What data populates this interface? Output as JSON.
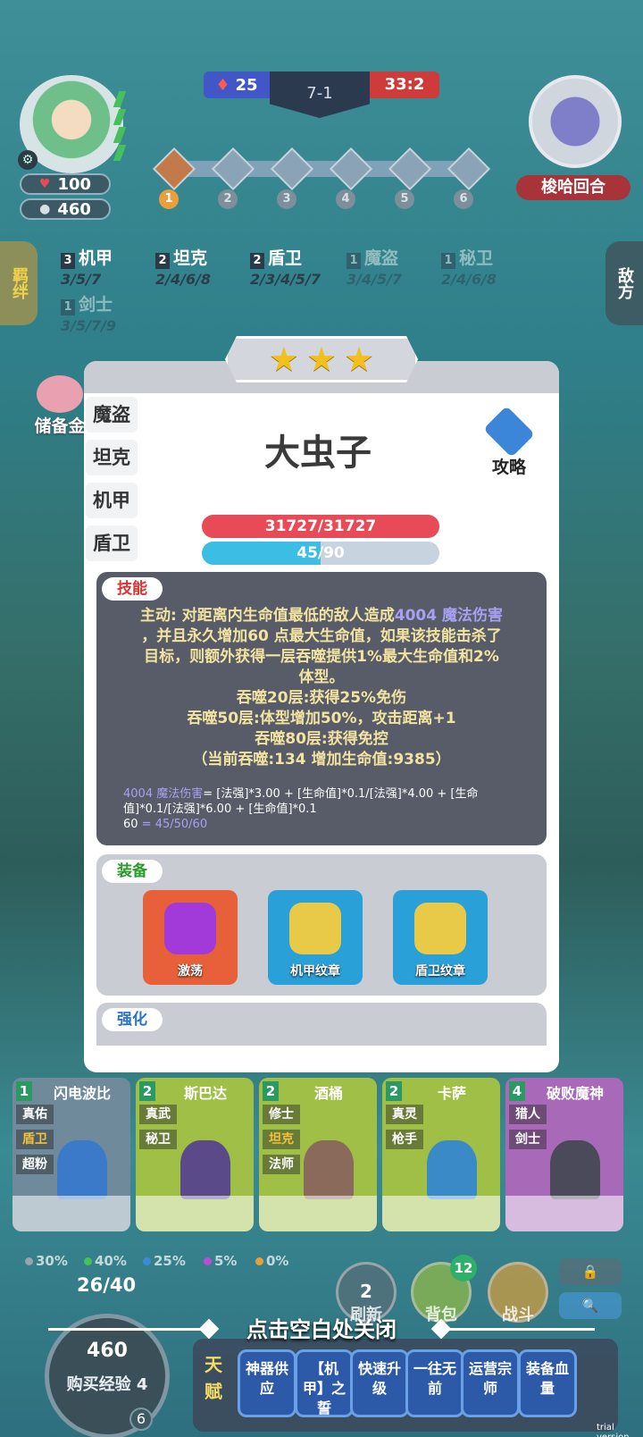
{
  "hud": {
    "hp": "100",
    "gold": "460",
    "blue_score": "25",
    "stage": "7-1",
    "red_score": "33:2",
    "enemy_label": "梭哈回合",
    "rounds": [
      "1",
      "2",
      "3",
      "4",
      "5",
      "6"
    ]
  },
  "side": {
    "left_tab": "羁绊",
    "right_tab": "敌方",
    "piggy_label": "储备金"
  },
  "synergies": [
    {
      "count": "3",
      "name": "机甲",
      "levels": "3/5/7",
      "active": true
    },
    {
      "count": "2",
      "name": "坦克",
      "levels": "2/4/6/8",
      "active": true
    },
    {
      "count": "2",
      "name": "盾卫",
      "levels": "2/3/4/5/7",
      "active": true
    },
    {
      "count": "1",
      "name": "魔盗",
      "levels": "3/4/5/7",
      "active": false
    },
    {
      "count": "1",
      "name": "秘卫",
      "levels": "2/4/6/8",
      "active": false
    },
    {
      "count": "1",
      "name": "剑士",
      "levels": "3/5/7/9",
      "active": false
    }
  ],
  "modal": {
    "stars": [
      "★",
      "★",
      "★"
    ],
    "role_tabs": [
      "魔盗",
      "坦克",
      "机甲",
      "盾卫"
    ],
    "unit_name": "大虫子",
    "guide_label": "攻略",
    "hp_text": "31727/31727",
    "hp_fraction": 1.0,
    "mp_text": "45/90",
    "mp_fraction": 0.5,
    "skill_title": "技能",
    "skill_line1_a": "主动: 对距离内生命值最低的敌人造成",
    "skill_line1_b": "4004 魔法伤害",
    "skill_line2": "，并且永久增加60 点最大生命值，如果该技能击杀了",
    "skill_line3": "目标，则额外获得一层吞噬提供1%最大生命值和2%",
    "skill_line4": "体型。",
    "skill_line5": "吞噬20层:获得25%免伤",
    "skill_line6": "吞噬50层:体型增加50%，攻击距离+1",
    "skill_line7": "吞噬80层:获得免控",
    "skill_line8": "（当前吞噬:134 增加生命值:9385）",
    "formula_a": "4004 魔法伤害",
    "formula_b": "= [法强]*3.00 + [生命值]*0.1/[法强]*4.00 + [生命值]*0.1/[法强]*6.00 + [生命值]*0.1",
    "formula_c": "60",
    "formula_d": " = 45/50/60",
    "equip_title": "装备",
    "equipment": [
      {
        "name": "激荡",
        "bg": "#e8603a",
        "gem": "#a13ad8"
      },
      {
        "name": "机甲纹章",
        "bg": "#2aa0d8",
        "gem": "#e9c948"
      },
      {
        "name": "盾卫纹章",
        "bg": "#2aa0d8",
        "gem": "#e9c948"
      }
    ],
    "enhance_title": "强化"
  },
  "shop": [
    {
      "cost": "1",
      "name": "闪电波比",
      "traits": [
        "真佑",
        "盾卫",
        "超粉"
      ],
      "highlight": [
        false,
        true,
        false
      ],
      "bg": "#6f8a9a",
      "fig": "#3a7ac8"
    },
    {
      "cost": "2",
      "name": "斯巴达",
      "traits": [
        "真武",
        "秘卫"
      ],
      "highlight": [
        false,
        false
      ],
      "bg": "#9fbf46",
      "fig": "#5a4a8a"
    },
    {
      "cost": "2",
      "name": "酒桶",
      "traits": [
        "修士",
        "坦克",
        "法师"
      ],
      "highlight": [
        false,
        true,
        false
      ],
      "bg": "#9fbf46",
      "fig": "#8a6a5a"
    },
    {
      "cost": "2",
      "name": "卡萨",
      "traits": [
        "真灵",
        "枪手"
      ],
      "highlight": [
        false,
        false
      ],
      "bg": "#9fbf46",
      "fig": "#3a8ac8"
    },
    {
      "cost": "4",
      "name": "破败魔神",
      "traits": [
        "猎人",
        "剑士"
      ],
      "highlight": [
        false,
        false
      ],
      "bg": "#a86ab8",
      "fig": "#4a4a5a"
    }
  ],
  "odds": [
    {
      "value": "30%",
      "color": "#9aa3aa"
    },
    {
      "value": "40%",
      "color": "#46c05c"
    },
    {
      "value": "25%",
      "color": "#3c8ad8"
    },
    {
      "value": "5%",
      "color": "#c04ad8"
    },
    {
      "value": "0%",
      "color": "#e8a03c"
    }
  ],
  "bottom": {
    "level_xp": "26/40",
    "gold": "460",
    "buy_xp_label": "购买经验 4",
    "level": "6",
    "refresh_cost": "2",
    "refresh_label": "刷新",
    "bag_label": "背包",
    "bag_count": "12",
    "battle_label": "战斗",
    "lock_icon": "🔒",
    "search_icon": "🔍",
    "close_hint": "点击空白处关闭",
    "talent_label": "天赋",
    "talents": [
      "神器供应",
      "【机甲】之誓",
      "快速升级",
      "一往无前",
      "运营宗师",
      "装备血量"
    ]
  },
  "watermark": "trial version"
}
